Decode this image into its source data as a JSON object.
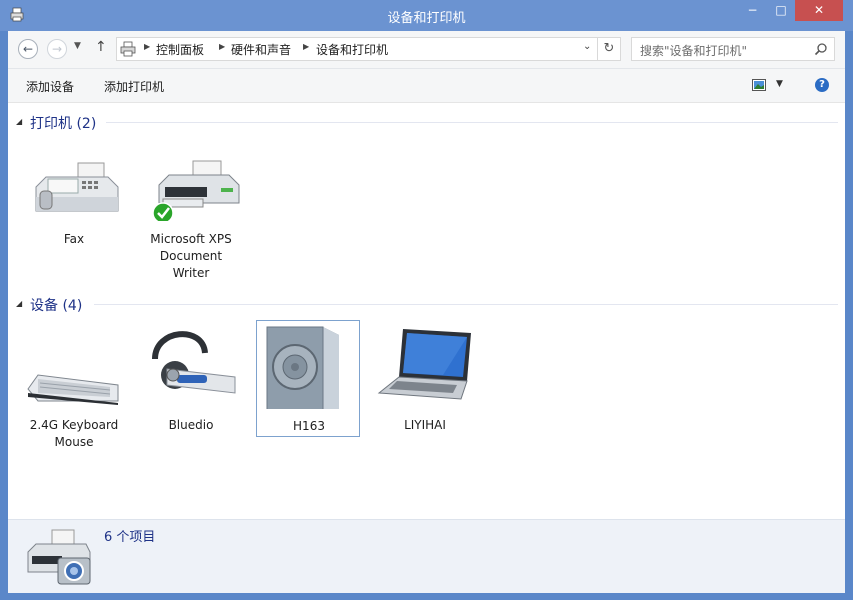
{
  "window": {
    "title": "设备和打印机",
    "min_label": "−",
    "max_label": "□",
    "close_label": "✕"
  },
  "address": {
    "breadcrumb": [
      "控制面板",
      "硬件和声音",
      "设备和打印机"
    ],
    "search_placeholder": "搜索\"设备和打印机\""
  },
  "commands": {
    "add_device": "添加设备",
    "add_printer": "添加打印机"
  },
  "groups": [
    {
      "title": "打印机 (2)",
      "items": [
        {
          "label": "Fax",
          "icon": "fax-icon"
        },
        {
          "label": "Microsoft XPS\nDocument\nWriter",
          "icon": "printer-icon"
        }
      ]
    },
    {
      "title": "设备 (4)",
      "items": [
        {
          "label": "2.4G Keyboard\nMouse",
          "icon": "keyboard-icon"
        },
        {
          "label": "Bluedio",
          "icon": "headset-icon"
        },
        {
          "label": "H163",
          "icon": "speaker-icon"
        },
        {
          "label": "LIYIHAI",
          "icon": "laptop-icon"
        }
      ]
    }
  ],
  "details": {
    "count_text": "6 个项目"
  },
  "colors": {
    "accent": "#6b93d1",
    "group_title": "#1e3287",
    "close": "#c75050"
  }
}
